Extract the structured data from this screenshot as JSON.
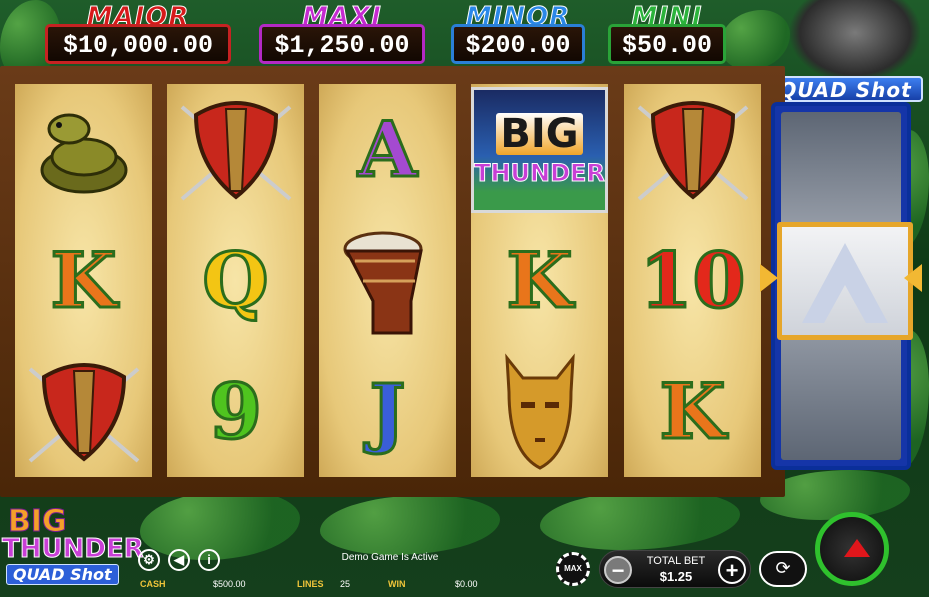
{
  "game": {
    "name_big": "BIG",
    "name_thunder": "THUNDER",
    "name_quadshot": "QUAD Shot"
  },
  "jackpots": {
    "major": {
      "label": "MAJOR",
      "value": "$10,000.00"
    },
    "maxi": {
      "label": "MAXI",
      "value": "$1,250.00"
    },
    "minor": {
      "label": "MINOR",
      "value": "$200.00"
    },
    "mini": {
      "label": "MINI",
      "value": "$50.00"
    }
  },
  "reels": [
    [
      "snake-symbol",
      "K",
      "shield-symbol"
    ],
    [
      "shield-symbol",
      "Q",
      "9"
    ],
    [
      "A",
      "drum-symbol",
      "J"
    ],
    [
      "big-thunder-symbol",
      "K",
      "mask-symbol"
    ],
    [
      "shield-symbol",
      "10",
      "K"
    ]
  ],
  "letters": {
    "r0s1": "K",
    "r1s1": "Q",
    "r1s2": "9",
    "r2s0": "A",
    "r2s2": "J",
    "r3s1": "K",
    "r4s1": "10",
    "r4s2": "K"
  },
  "big_thunder_symbol": {
    "top": "BIG",
    "bottom": "THUNDER"
  },
  "status": {
    "demo": "Demo Game Is Active",
    "cash_label": "CASH",
    "cash_value": "$500.00",
    "lines_label": "LINES",
    "lines_value": "25",
    "win_label": "WIN",
    "win_value": "$0.00"
  },
  "bet": {
    "label": "TOTAL BET",
    "value": "$1.25",
    "minus": "−",
    "plus": "+"
  },
  "controls": {
    "max": "MAX"
  },
  "colors": {
    "major": "#c62222",
    "maxi": "#b329c4",
    "minor": "#2a7fd6",
    "mini": "#2aa338",
    "spin_ring": "#2fc12d"
  }
}
